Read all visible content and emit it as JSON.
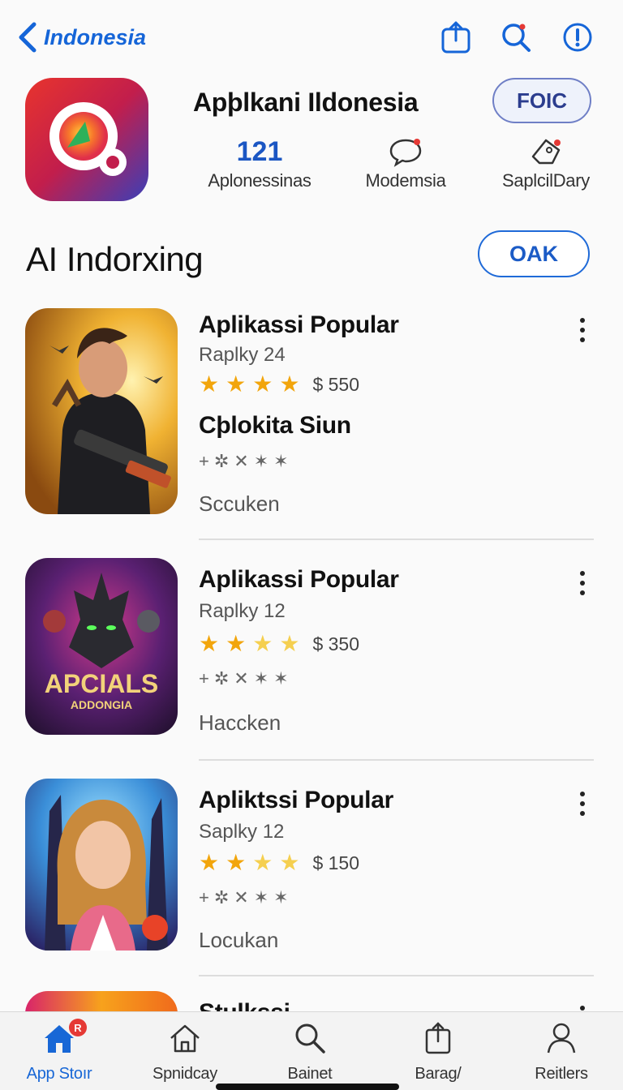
{
  "nav": {
    "back_label": "Indonesia"
  },
  "header": {
    "app_title": "Apþlkani Ildonesia",
    "get_label": "FOIC",
    "stats": [
      {
        "value": "121",
        "caption": "Aplonessinas"
      },
      {
        "caption": "Modemsia"
      },
      {
        "caption": "SaplcilDary"
      }
    ]
  },
  "section": {
    "title": "AI  Indorxing",
    "see_all_label": "OAK"
  },
  "apps": [
    {
      "title": "Aplikassi Popular",
      "subtitle": "Raplky 24",
      "rating": 4,
      "price": "$ 550",
      "subtitle2": "Cþlokita Siun",
      "marks": "+✲✕✶✶",
      "category": "Scсuken",
      "thumb_text": ""
    },
    {
      "title": "Aplikassi Popular",
      "subtitle": "Raplky 12",
      "rating": 4,
      "price": "$ 350",
      "subtitle2": "",
      "marks": "+✲✕✶✶",
      "category": "Haccken",
      "thumb_text": "APCIALS",
      "thumb_text2": "ADDONGIA"
    },
    {
      "title": "Apliktssi Popular",
      "subtitle": "Saplky 12",
      "rating": 4,
      "price": "$ 150",
      "subtitle2": "",
      "marks": "+✲✕✶✶",
      "category": "Locukan",
      "thumb_text": ""
    },
    {
      "title": "Stulkssi"
    }
  ],
  "tabs": [
    {
      "label": "App Stoır",
      "icon": "home-icon",
      "badge": "R"
    },
    {
      "label": "Spnidcay",
      "icon": "house-outline-icon"
    },
    {
      "label": "Bainet",
      "icon": "search-icon"
    },
    {
      "label": "Barag/",
      "icon": "share-icon"
    },
    {
      "label": "Reitlers",
      "icon": "person-icon"
    }
  ],
  "colors": {
    "accent": "#1867d6",
    "star": "#f2a50c",
    "badge": "#e53935"
  }
}
